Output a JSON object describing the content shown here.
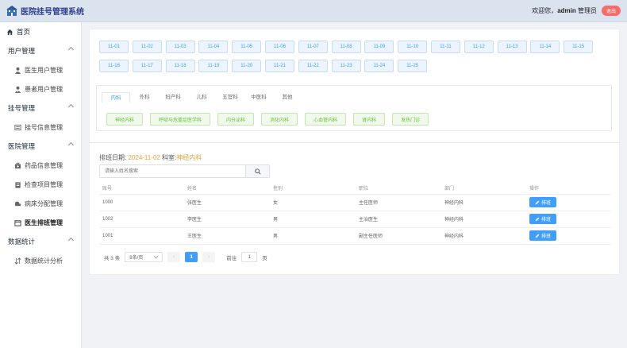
{
  "header": {
    "app_title": "医院挂号管理系统",
    "welcome": "欢迎您，",
    "username": "admin",
    "role": "管理员",
    "logout_label": "退出"
  },
  "sidebar": {
    "home": "首页",
    "groups": [
      {
        "label": "用户管理",
        "items": [
          "医生用户管理",
          "患者用户管理"
        ]
      },
      {
        "label": "挂号管理",
        "items": [
          "挂号信息管理"
        ]
      },
      {
        "label": "医院管理",
        "items": [
          "药品信息管理",
          "检查项目管理",
          "病床分配管理",
          "医生排班管理"
        ]
      },
      {
        "label": "数据统计",
        "items": [
          "数据统计分析"
        ]
      }
    ],
    "active_item": "医生排班管理"
  },
  "dates": [
    "11-01",
    "11-02",
    "11-03",
    "11-04",
    "11-05",
    "11-06",
    "11-07",
    "11-08",
    "11-09",
    "11-10",
    "11-11",
    "11-12",
    "11-13",
    "11-14",
    "11-15",
    "11-16",
    "11-17",
    "11-18",
    "11-19",
    "11-20",
    "11-21",
    "11-22",
    "11-23",
    "11-24",
    "11-25"
  ],
  "departments": {
    "tabs": [
      "内科",
      "外科",
      "妇产科",
      "儿科",
      "五官科",
      "中医科",
      "其他"
    ],
    "active_tab": "内科",
    "subdepts": [
      "神经内科",
      "呼吸与危重症医学科",
      "内分泌科",
      "消化内科",
      "心血管内科",
      "肾内科",
      "发热门诊"
    ]
  },
  "schedule": {
    "date_label": "排班日期:",
    "date_value": "2024-11-02",
    "dept_label": "科室:",
    "dept_value": "神经内科"
  },
  "search": {
    "placeholder": "请输入姓名搜索"
  },
  "table": {
    "columns": [
      "账号",
      "姓名",
      "性别",
      "职位",
      "部门",
      "操作"
    ],
    "rows": [
      {
        "account": "1000",
        "name": "张医生",
        "gender": "女",
        "position": "主任医师",
        "dept": "神经内科"
      },
      {
        "account": "1002",
        "name": "李医生",
        "gender": "男",
        "position": "主治医生",
        "dept": "神经内科"
      },
      {
        "account": "1001",
        "name": "王医生",
        "gender": "男",
        "position": "副主任医师",
        "dept": "神经内科"
      }
    ],
    "action_label": "排班"
  },
  "pagination": {
    "total": "共 3 条",
    "page_size": "8条/页",
    "current_page": "1",
    "goto_label": "前往",
    "goto_value": "1",
    "page_unit": "页"
  },
  "colors": {
    "accent": "#409eff",
    "tag_green": "#67c23a",
    "highlight": "#e6a23c",
    "logout": "#f56c6c"
  }
}
